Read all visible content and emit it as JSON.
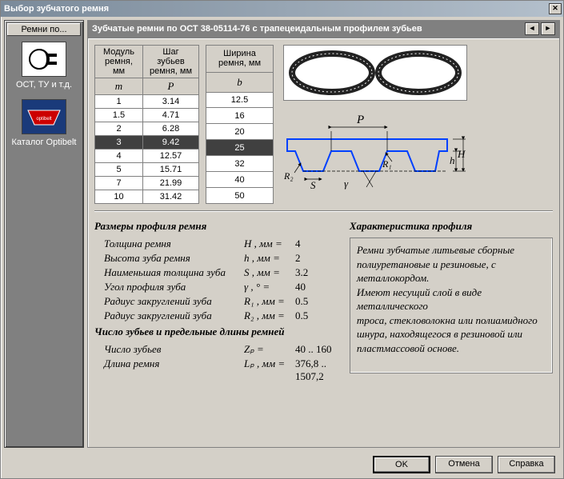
{
  "window": {
    "title": "Выбор зубчатого ремня"
  },
  "sidebar": {
    "header": "Ремни по...",
    "items": [
      {
        "label": "ОСТ, ТУ и т.д."
      },
      {
        "label": "Каталог Optibelt"
      }
    ]
  },
  "header": {
    "title": "Зубчатые ремни по ОСТ 38-05114-76 с трапецеидальным профилем зубьев"
  },
  "table_mp": {
    "col1": "Модуль ремня, мм",
    "col2": "Шаг зубьев ремня, мм",
    "sym1": "m",
    "sym2": "P",
    "rows": [
      {
        "m": "1",
        "p": "3.14"
      },
      {
        "m": "1.5",
        "p": "4.71"
      },
      {
        "m": "2",
        "p": "6.28"
      },
      {
        "m": "3",
        "p": "9.42",
        "sel": true
      },
      {
        "m": "4",
        "p": "12.57"
      },
      {
        "m": "5",
        "p": "15.71"
      },
      {
        "m": "7",
        "p": "21.99"
      },
      {
        "m": "10",
        "p": "31.42"
      }
    ]
  },
  "table_b": {
    "col1": "Ширина ремня, мм",
    "sym1": "b",
    "rows": [
      {
        "b": "12.5"
      },
      {
        "b": "16"
      },
      {
        "b": "20"
      },
      {
        "b": "25",
        "sel": true
      },
      {
        "b": "32"
      },
      {
        "b": "40"
      },
      {
        "b": "50"
      }
    ]
  },
  "diagram_labels": {
    "P": "P",
    "S": "S",
    "R1": "R₁",
    "R2": "R₂",
    "gamma": "γ",
    "h": "h",
    "H": "H"
  },
  "params": {
    "title": "Размеры профиля ремня",
    "rows": [
      {
        "lbl": "Толщина ремня",
        "sym": "H , мм  =",
        "val": "4"
      },
      {
        "lbl": "Высота зуба ремня",
        "sym": "h , мм  =",
        "val": "2"
      },
      {
        "lbl": "Наименьшая толщина зуба",
        "sym": "S , мм  =",
        "val": "3.2"
      },
      {
        "lbl": "Угол профиля зуба",
        "sym": "γ , °    =",
        "val": "40"
      },
      {
        "lbl": "Радиус закруглений зуба",
        "sym": "R₁ , мм =",
        "val": "0.5"
      },
      {
        "lbl": "Радиус закруглений зуба",
        "sym": "R₂ , мм =",
        "val": "0.5"
      }
    ],
    "title2": "Число зубьев и предельные длины ремней",
    "rows2": [
      {
        "lbl": "Число зубьев",
        "sym": "Zₚ       =",
        "val": "40 .. 160"
      },
      {
        "lbl": "Длина ремня",
        "sym": "Lₚ , мм =",
        "val": "376,8 .. 1507,2"
      }
    ]
  },
  "characteristics": {
    "title": "Характеристика профиля",
    "text": "Ремни зубчатые литьевые сборные полиуретановые и резиновые, с металлокордом.\nИмеют несущий слой в виде металлического\nтроса, стекловолокна или полиамидного\nшнура, находящегося в резиновой или пластмассовой основе."
  },
  "buttons": {
    "ok": "OK",
    "cancel": "Отмена",
    "help": "Справка"
  }
}
